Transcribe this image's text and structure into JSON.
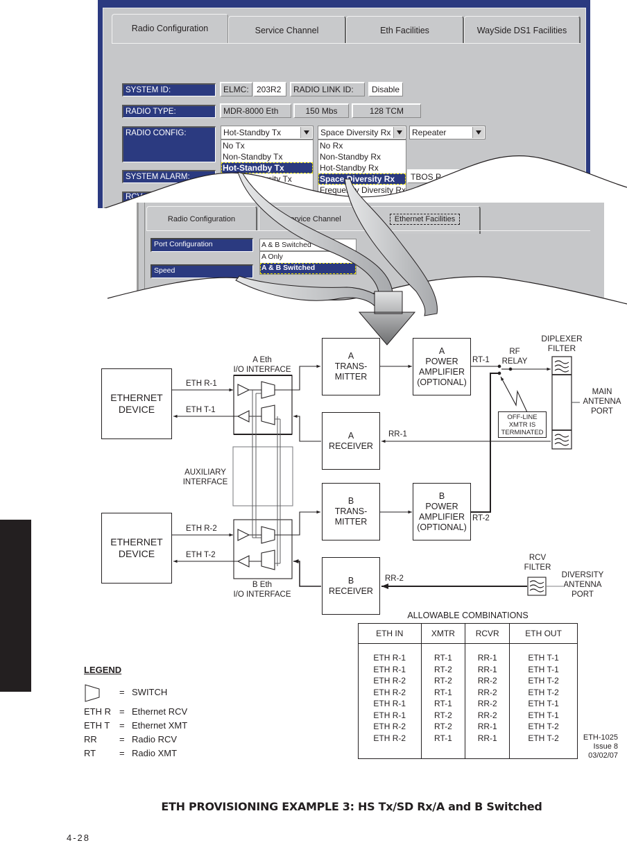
{
  "screenshot1": {
    "tabs": [
      "Radio Configuration",
      "Service Channel",
      "Eth Facilities",
      "WaySide DS1 Facilities"
    ],
    "active_tab": "Radio Configuration",
    "system_id": {
      "label": "SYSTEM ID:",
      "elmc_label": "ELMC:",
      "elmc_value": "203R2",
      "radio_link_label": "RADIO LINK ID:",
      "radio_link_value": "Disable"
    },
    "radio_type": {
      "label": "RADIO TYPE:",
      "model": "MDR-8000 Eth",
      "rate": "150 Mbs",
      "modulation": "128 TCM"
    },
    "radio_config": {
      "label": "RADIO CONFIG:",
      "tx_selected": "Hot-Standby Tx",
      "tx_options": [
        "No Tx",
        "Non-Standby Tx",
        "Hot-Standby Tx",
        "Space Diversity Tx"
      ],
      "rx_selected": "Space Diversity Rx",
      "rx_options": [
        "No Rx",
        "Non-Standby Rx",
        "Hot-Standby Rx",
        "Space Diversity Rx",
        "Frequency Diversity Rx"
      ],
      "repeater_selected": "Repeater"
    },
    "system_alarm": {
      "label": "SYSTEM ALARM:",
      "partial_value": "TBOS P"
    },
    "rcv_partial_label": "RCV"
  },
  "screenshot2": {
    "tabs": [
      "Radio Configuration",
      "Service Channel",
      "Ethernet Facilities"
    ],
    "active_tab": "Ethernet Facilities",
    "port_config": {
      "label": "Port Configuration",
      "selected": "A & B Switched",
      "options": [
        "A Only",
        "A & B Switched"
      ]
    },
    "speed": {
      "label": "Speed"
    }
  },
  "diagram": {
    "ethernet_device_1": "ETHERNET\nDEVICE",
    "ethernet_device_2": "ETHERNET\nDEVICE",
    "a_eth_io": "A Eth\nI/O INTERFACE",
    "b_eth_io": "B Eth\nI/O INTERFACE",
    "aux_interface": "AUXILIARY\nINTERFACE",
    "a_transmitter": "A\nTRANS-\nMITTER",
    "a_receiver": "A\nRECEIVER",
    "b_transmitter": "B\nTRANS-\nMITTER",
    "b_receiver": "B\nRECEIVER",
    "a_power_amp": "A\nPOWER\nAMPLIFIER\n(OPTIONAL)",
    "b_power_amp": "B\nPOWER\nAMPLIFIER\n(OPTIONAL)",
    "rf_relay": "RF\nRELAY",
    "diplexer_filter": "DIPLEXER\nFILTER",
    "main_antenna_port": "MAIN\nANTENNA\nPORT",
    "offline_note": "OFF-LINE\nXMTR IS\nTERMINATED",
    "rcv_filter": "RCV\nFILTER",
    "diversity_antenna_port": "DIVERSITY\nANTENNA\nPORT",
    "signals": {
      "eth_r1": "ETH R-1",
      "eth_t1": "ETH T-1",
      "eth_r2": "ETH R-2",
      "eth_t2": "ETH T-2",
      "rt1": "RT-1",
      "rt2": "RT-2",
      "rr1": "RR-1",
      "rr2": "RR-2"
    }
  },
  "combinations": {
    "title": "ALLOWABLE COMBINATIONS",
    "headers": [
      "ETH IN",
      "XMTR",
      "RCVR",
      "ETH OUT"
    ],
    "rows": [
      [
        "ETH R-1",
        "RT-1",
        "RR-1",
        "ETH T-1"
      ],
      [
        "ETH R-1",
        "RT-2",
        "RR-1",
        "ETH T-1"
      ],
      [
        "ETH R-2",
        "RT-2",
        "RR-2",
        "ETH T-2"
      ],
      [
        "ETH R-2",
        "RT-1",
        "RR-2",
        "ETH T-2"
      ],
      [
        "ETH R-1",
        "RT-1",
        "RR-2",
        "ETH T-1"
      ],
      [
        "ETH R-1",
        "RT-2",
        "RR-2",
        "ETH T-1"
      ],
      [
        "ETH R-2",
        "RT-2",
        "RR-1",
        "ETH T-2"
      ],
      [
        "ETH R-2",
        "RT-1",
        "RR-1",
        "ETH T-2"
      ]
    ]
  },
  "legend": {
    "title": "LEGEND",
    "items": [
      {
        "key": "",
        "icon": "switch-icon",
        "value": "SWITCH"
      },
      {
        "key": "ETH R",
        "value": "Ethernet RCV"
      },
      {
        "key": "ETH T",
        "value": "Ethernet XMT"
      },
      {
        "key": "RR",
        "value": "Radio RCV"
      },
      {
        "key": "RT",
        "value": "Radio XMT"
      }
    ]
  },
  "doc_id": {
    "number": "ETH-1025",
    "issue": "Issue 8",
    "date": "03/02/07"
  },
  "caption": "ETH PROVISIONING EXAMPLE 3:  HS Tx/SD Rx/A and B Switched",
  "page_number": "4-28"
}
